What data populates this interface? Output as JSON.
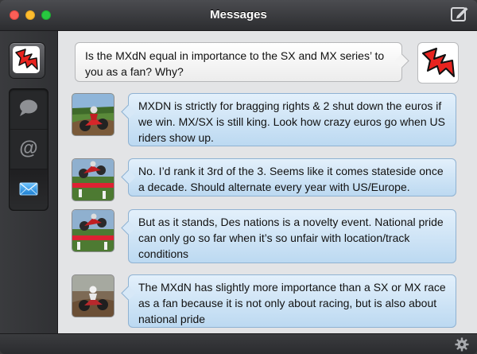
{
  "window": {
    "title": "Messages"
  },
  "toolbar": {
    "compose_icon": "compose-icon"
  },
  "sidebar": {
    "profile_icon": "red-lightning-logo-icon",
    "nav": [
      {
        "icon": "chat-bubble-icon"
      },
      {
        "icon": "at-sign-icon",
        "glyph": "@"
      },
      {
        "icon": "mail-icon",
        "selected": true
      }
    ]
  },
  "question": {
    "text": "Is the MXdN equal in importance to the SX and MX series’ to you as a fan? Why?"
  },
  "replies": [
    {
      "text": "MXDN is strictly for bragging rights & 2 shut down the euros if we win. MX/SX is still king. Look how crazy euros go when US riders show up."
    },
    {
      "text": "No. I’d rank it 3rd of the 3. Seems like it comes stateside once a decade. Should alternate every year with US/Europe."
    },
    {
      "text": "But as it stands, Des nations is a novelty event. National pride can only go so far when it’s so unfair with location/track conditions"
    },
    {
      "text": "The MXdN has slightly more importance than a SX or MX race as a fan because it is not only about racing, but is also about national pride"
    }
  ],
  "footer": {
    "settings_icon": "gear-icon"
  },
  "colors": {
    "reply_bubble": "#cfe4f6",
    "question_bubble": "#f5f5f5",
    "brand_red": "#e8231f",
    "selected_mail": "#3aa0e6"
  }
}
